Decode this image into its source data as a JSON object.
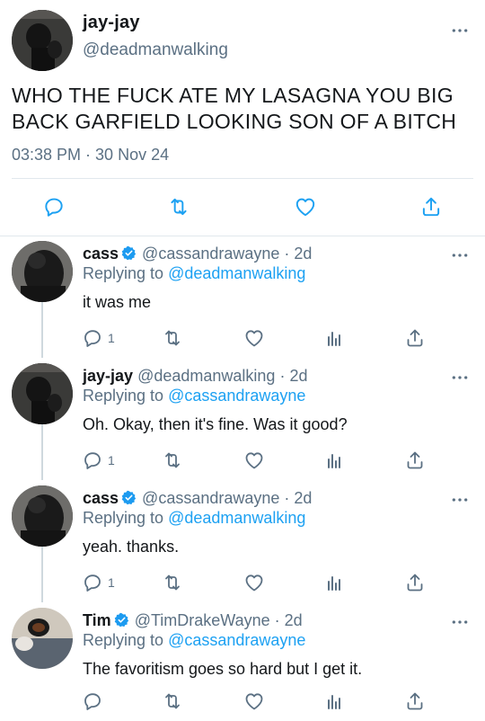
{
  "main_tweet": {
    "display_name": "jay-jay",
    "handle": "@deadmanwalking",
    "text": "WHO THE FUCK ATE MY LASAGNA YOU BIG BACK GARFIELD LOOKING SON OF A BITCH",
    "timestamp": "03:38 PM · 30 Nov 24"
  },
  "replies": [
    {
      "display_name": "cass",
      "verified": true,
      "handle": "@cassandrawayne",
      "age": "· 2d",
      "replying_prefix": "Replying to ",
      "replying_to": "@deadmanwalking",
      "text": "it was me",
      "reply_count": "1"
    },
    {
      "display_name": "jay-jay",
      "verified": false,
      "handle": "@deadmanwalking",
      "age": "· 2d",
      "replying_prefix": "Replying to ",
      "replying_to": "@cassandrawayne",
      "text": "Oh. Okay, then it's fine. Was it good?",
      "reply_count": "1"
    },
    {
      "display_name": "cass",
      "verified": true,
      "handle": "@cassandrawayne",
      "age": "· 2d",
      "replying_prefix": "Replying to ",
      "replying_to": "@deadmanwalking",
      "text": "yeah. thanks.",
      "reply_count": "1"
    },
    {
      "display_name": "Tim",
      "verified": true,
      "handle": "@TimDrakeWayne",
      "age": "· 2d",
      "replying_prefix": "Replying to ",
      "replying_to": "@cassandrawayne",
      "text": "The favoritism goes so hard but I get it.",
      "reply_count": ""
    }
  ],
  "colors": {
    "link": "#1da1f2",
    "verified": "#1d9bf0",
    "secondary_text": "#5b7083",
    "divider": "#e1e8ed",
    "thread_line": "#cfd9de"
  },
  "icons": [
    "more-icon",
    "reply-icon",
    "retweet-icon",
    "like-icon",
    "analytics-icon",
    "share-icon",
    "verified-icon"
  ]
}
